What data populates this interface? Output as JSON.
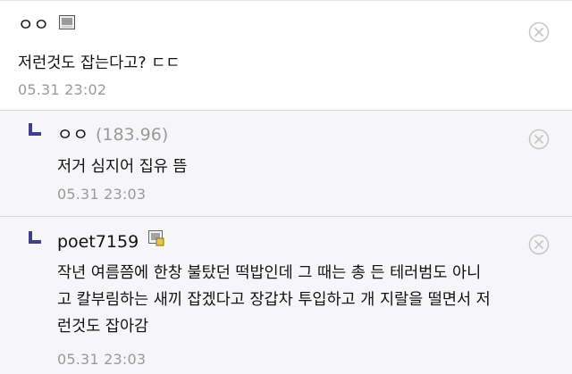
{
  "comments": [
    {
      "author": "ㅇㅇ",
      "ip": "",
      "text": "저런것도 잡는다고? ㄷㄷ",
      "time": "05.31 23:02"
    },
    {
      "author": "ㅇㅇ",
      "ip": "(183.96)",
      "text": "저거 심지어 집유 뜸",
      "time": "05.31 23:03"
    },
    {
      "author": "poet7159",
      "ip": "",
      "text_lines": [
        "작년 여름쯤에 한창 불탔던 떡밥인데 그 때는 총 든 테러범도 아니",
        "고 칼부림하는 새끼 잡겠다고 장갑차 투입하고 개 지랄을 떨면서 저",
        "런것도 잡아감"
      ],
      "time": "05.31 23:03"
    }
  ],
  "icons": {
    "member_badge": "fixed-member-icon",
    "delete": "close-circle-icon",
    "reply": "reply-arrow-icon"
  },
  "colors": {
    "reply_marker": "#3e3f8f",
    "reply_background": "#f6f6f9",
    "meta_text": "#9a9a9a"
  }
}
